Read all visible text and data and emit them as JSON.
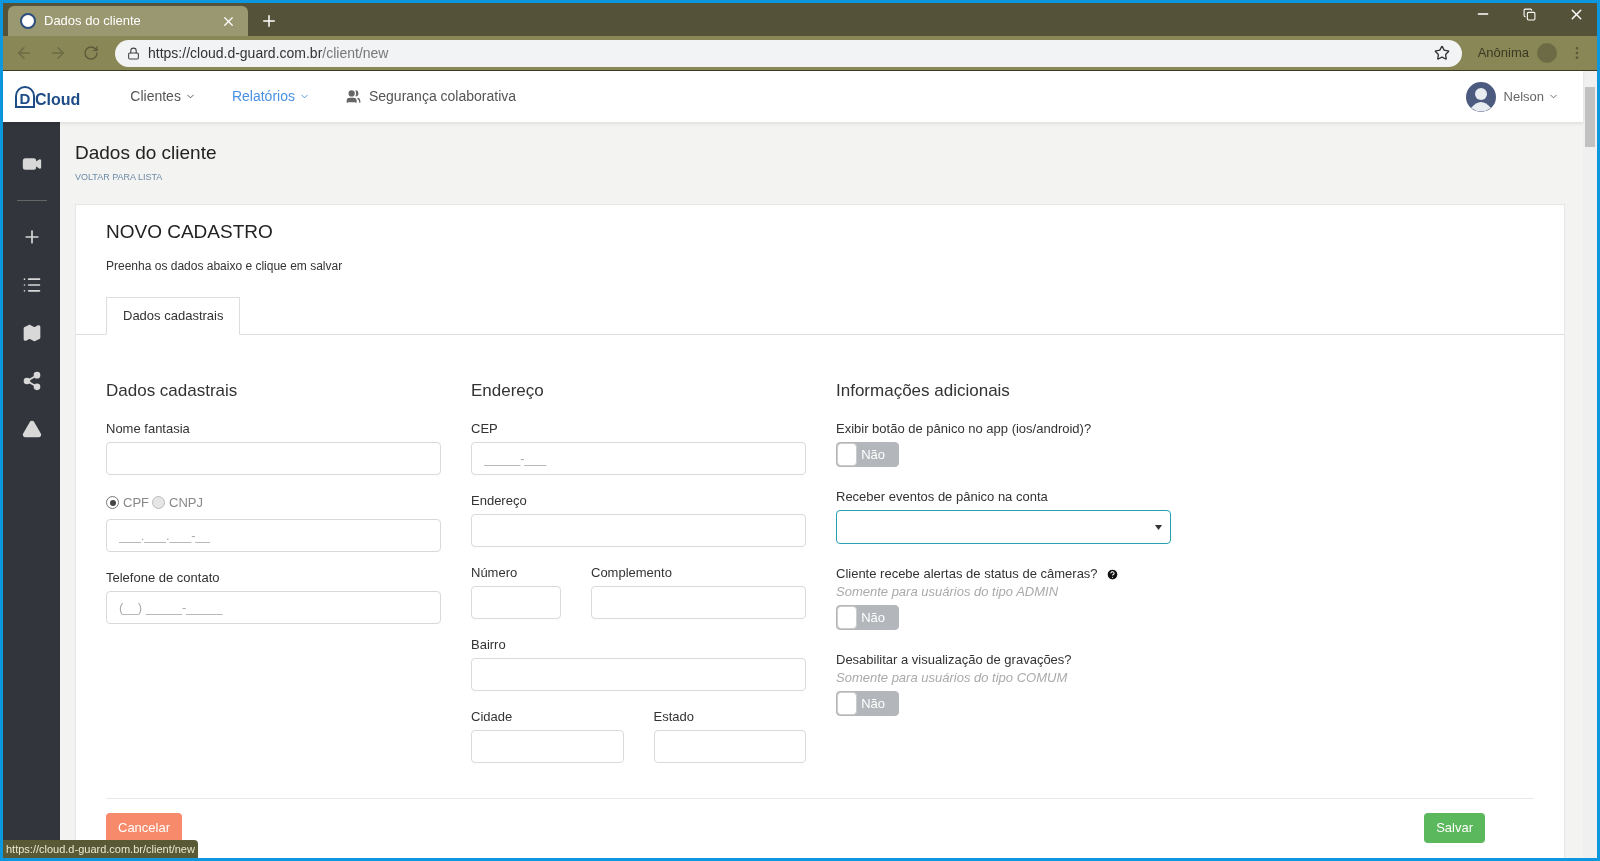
{
  "browser": {
    "tab_title": "Dados do cliente",
    "url_host": "https://cloud.d-guard.com.br",
    "url_path": "/client/new",
    "profile": "Anônima",
    "status_url": "https://cloud.d-guard.com.br/client/new"
  },
  "logo": {
    "letter": "D",
    "text": "Cloud"
  },
  "nav": [
    {
      "label": "Clientes",
      "selected": false,
      "kind": "dropdown"
    },
    {
      "label": "Relatórios",
      "selected": true,
      "kind": "dropdown"
    },
    {
      "label": "Segurança colaborativa",
      "selected": false,
      "kind": "group"
    }
  ],
  "user": {
    "name": "Nelson"
  },
  "page": {
    "title": "Dados do cliente",
    "back_link": "VOLTAR PARA LISTA"
  },
  "card": {
    "title": "NOVO CADASTRO",
    "subtitle": "Preenha os dados abaixo e clique em salvar"
  },
  "tabs": [
    {
      "label": "Dados cadastrais",
      "selected": true
    }
  ],
  "registration": {
    "heading": "Dados cadastrais",
    "items": [
      {
        "kind": "field",
        "label": "Nome fantasia"
      },
      {
        "kind": "radio_field",
        "radios": [
          {
            "label": "CPF",
            "selected": true
          },
          {
            "label": "CNPJ",
            "selected": false
          }
        ],
        "placeholder": "___.___.___-__"
      },
      {
        "kind": "field",
        "label": "Telefone de contato",
        "placeholder": "(__) _____-_____"
      }
    ]
  },
  "address": {
    "heading": "Endereço",
    "rows": [
      [
        {
          "label": "CEP",
          "placeholder": "_____-___"
        }
      ],
      [
        {
          "label": "Endereço"
        }
      ],
      [
        {
          "label": "Número"
        },
        {
          "label": "Complemento"
        }
      ],
      [
        {
          "label": "Bairro"
        }
      ],
      [
        {
          "label": "Cidade"
        },
        {
          "label": "Estado"
        }
      ]
    ]
  },
  "additional": {
    "heading": "Informações adicionais",
    "items": [
      {
        "kind": "toggle",
        "label": "Exibir botão de pânico no app (ios/android)?",
        "on": false,
        "text": "Não"
      },
      {
        "kind": "select",
        "label": "Receber eventos de pânico na conta"
      },
      {
        "kind": "toggle",
        "label": "Cliente recebe alertas de status de câmeras?",
        "help": true,
        "hint": "Somente para usuários do tipo ADMIN",
        "on": false,
        "text": "Não"
      },
      {
        "kind": "toggle",
        "label": "Desabilitar a visualização de gravações?",
        "help": false,
        "hint": "Somente para usuários do tipo COMUM",
        "on": false,
        "text": "Não"
      }
    ]
  },
  "buttons": {
    "cancel": "Cancelar",
    "save": "Salvar"
  }
}
